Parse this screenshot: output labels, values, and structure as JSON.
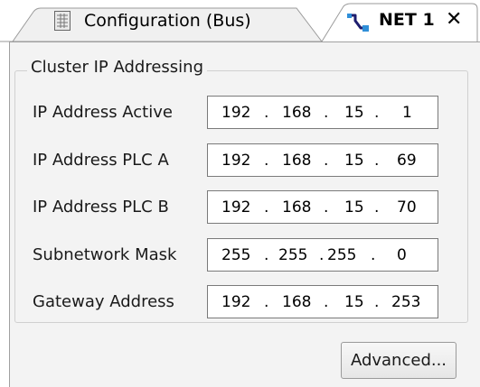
{
  "tabs": [
    {
      "label": "Configuration (Bus)",
      "icon": "grid-document-icon",
      "active": false
    },
    {
      "label": "NET 1",
      "icon": "network-cable-icon",
      "active": true
    }
  ],
  "close_label": "✕",
  "group": {
    "title": "Cluster IP Addressing"
  },
  "fields": [
    {
      "label": "IP Address Active",
      "octets": [
        "192",
        "168",
        "15",
        "1"
      ]
    },
    {
      "label": "IP Address PLC A",
      "octets": [
        "192",
        "168",
        "15",
        "69"
      ]
    },
    {
      "label": "IP Address PLC B",
      "octets": [
        "192",
        "168",
        "15",
        "70"
      ]
    },
    {
      "label": "Subnetwork Mask",
      "octets": [
        "255",
        "255",
        "255",
        "0"
      ]
    },
    {
      "label": "Gateway Address",
      "octets": [
        "192",
        "168",
        "15",
        "253"
      ]
    }
  ],
  "advanced_button": "Advanced..."
}
